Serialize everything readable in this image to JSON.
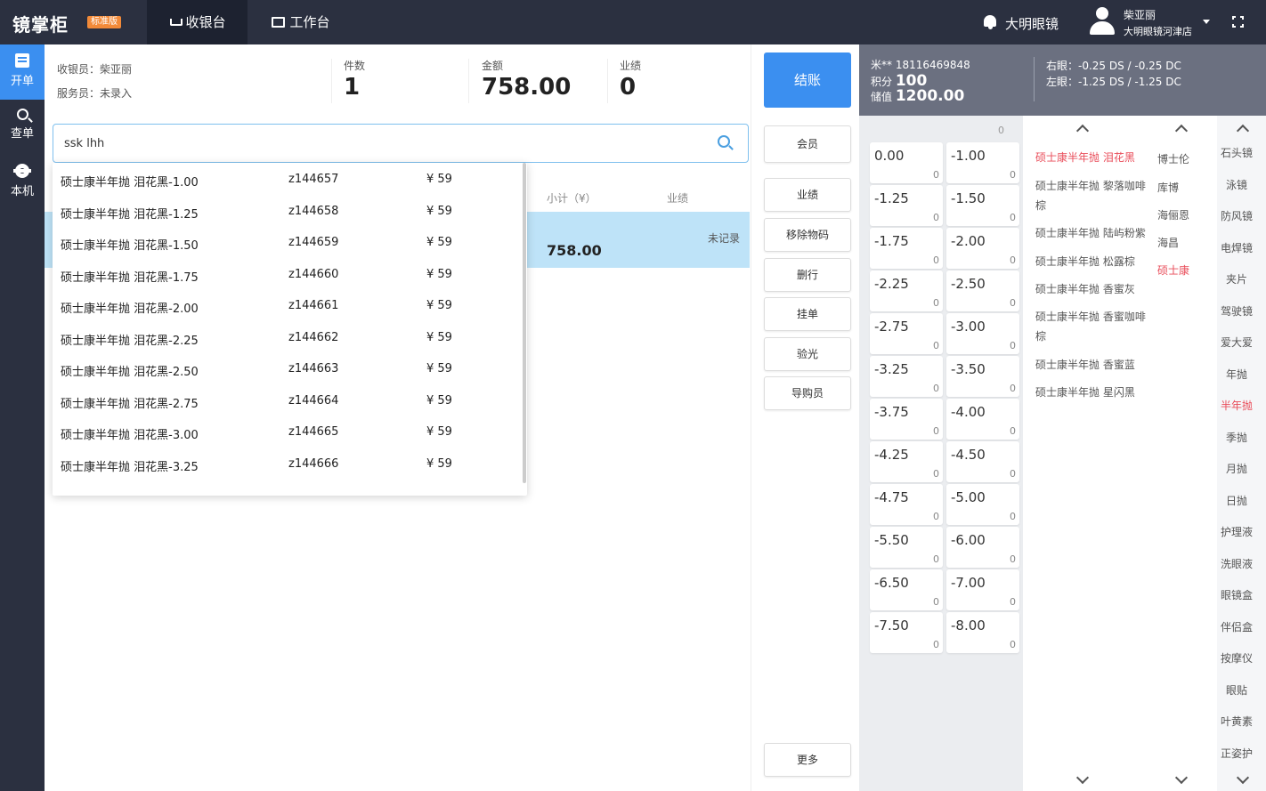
{
  "app": {
    "logo": "镜掌柜",
    "edition": "标准版"
  },
  "nav": {
    "tabs": [
      {
        "label": "收银台"
      },
      {
        "label": "工作台"
      }
    ]
  },
  "header": {
    "store_name": "大明眼镜",
    "user_name": "柴亚丽",
    "user_store": "大明眼镜河津店"
  },
  "sidebar": {
    "items": [
      {
        "label": "开单"
      },
      {
        "label": "查单"
      },
      {
        "label": "本机"
      }
    ]
  },
  "order": {
    "cashier": "收银员：柴亚丽",
    "clerk": "服务员：未录入",
    "count_label": "件数",
    "count_value": "1",
    "amount_label": "金额",
    "amount_value": "758.00",
    "perf_label": "业绩",
    "perf_value": "0"
  },
  "search": {
    "value": "ssk lhh"
  },
  "table": {
    "headers": {
      "subtotal": "小计（¥）",
      "perf": "业绩"
    },
    "row": {
      "subtotal": "758.00",
      "status": "未记录"
    }
  },
  "dropdown": {
    "items": [
      {
        "name": "硕士康半年抛 泪花黑-1.00",
        "code": "z144657",
        "price": "¥ 59"
      },
      {
        "name": "硕士康半年抛 泪花黑-1.25",
        "code": "z144658",
        "price": "¥ 59"
      },
      {
        "name": "硕士康半年抛 泪花黑-1.50",
        "code": "z144659",
        "price": "¥ 59"
      },
      {
        "name": "硕士康半年抛 泪花黑-1.75",
        "code": "z144660",
        "price": "¥ 59"
      },
      {
        "name": "硕士康半年抛 泪花黑-2.00",
        "code": "z144661",
        "price": "¥ 59"
      },
      {
        "name": "硕士康半年抛 泪花黑-2.25",
        "code": "z144662",
        "price": "¥ 59"
      },
      {
        "name": "硕士康半年抛 泪花黑-2.50",
        "code": "z144663",
        "price": "¥ 59"
      },
      {
        "name": "硕士康半年抛 泪花黑-2.75",
        "code": "z144664",
        "price": "¥ 59"
      },
      {
        "name": "硕士康半年抛 泪花黑-3.00",
        "code": "z144665",
        "price": "¥ 59"
      },
      {
        "name": "硕士康半年抛 泪花黑-3.25",
        "code": "z144666",
        "price": "¥ 59"
      }
    ]
  },
  "actions": {
    "checkout": "结账",
    "member": "会员",
    "perf": "业绩",
    "remove": "移除物码",
    "delete_row": "删行",
    "hold": "挂单",
    "optometry": "验光",
    "guide": "导购员",
    "more": "更多"
  },
  "member": {
    "phone": "米** 18116469848",
    "points_label": "积分",
    "points": "100",
    "balance_label": "储值",
    "balance": "1200.00",
    "right_eye": "右眼：-0.25 DS / -0.25 DC",
    "left_eye": "左眼：-1.25 DS / -1.25 DC"
  },
  "degrees": {
    "top_count": "0",
    "items": [
      {
        "v": "0.00",
        "c": "0"
      },
      {
        "v": "-1.00",
        "c": "0"
      },
      {
        "v": "-1.25",
        "c": "0"
      },
      {
        "v": "-1.50",
        "c": "0"
      },
      {
        "v": "-1.75",
        "c": "0"
      },
      {
        "v": "-2.00",
        "c": "0"
      },
      {
        "v": "-2.25",
        "c": "0"
      },
      {
        "v": "-2.50",
        "c": "0"
      },
      {
        "v": "-2.75",
        "c": "0"
      },
      {
        "v": "-3.00",
        "c": "0"
      },
      {
        "v": "-3.25",
        "c": "0"
      },
      {
        "v": "-3.50",
        "c": "0"
      },
      {
        "v": "-3.75",
        "c": "0"
      },
      {
        "v": "-4.00",
        "c": "0"
      },
      {
        "v": "-4.25",
        "c": "0"
      },
      {
        "v": "-4.50",
        "c": "0"
      },
      {
        "v": "-4.75",
        "c": "0"
      },
      {
        "v": "-5.00",
        "c": "0"
      },
      {
        "v": "-5.50",
        "c": "0"
      },
      {
        "v": "-6.00",
        "c": "0"
      },
      {
        "v": "-6.50",
        "c": "0"
      },
      {
        "v": "-7.00",
        "c": "0"
      },
      {
        "v": "-7.50",
        "c": "0"
      },
      {
        "v": "-8.00",
        "c": "0"
      }
    ]
  },
  "products": [
    "硕士康半年抛 泪花黑",
    "硕士康半年抛 黎落咖啡棕",
    "硕士康半年抛 陆屿粉紫",
    "硕士康半年抛 松露棕",
    "硕士康半年抛 香蜜灰",
    "硕士康半年抛 香蜜咖啡棕",
    "硕士康半年抛 香蜜蓝",
    "硕士康半年抛 星闪黑"
  ],
  "brands": [
    "博士伦",
    "库博",
    "海俪恩",
    "海昌",
    "硕士康"
  ],
  "categories": [
    "石头镜",
    "泳镜",
    "防风镜",
    "电焊镜",
    "夹片",
    "驾驶镜",
    "爱大爱",
    "年抛",
    "半年抛",
    "季抛",
    "月抛",
    "日抛",
    "护理液",
    "洗眼液",
    "眼镜盒",
    "伴侣盒",
    "按摩仪",
    "眼贴",
    "叶黄素",
    "正姿护"
  ],
  "colors": {
    "accent": "#3b8ff0",
    "nav_bg": "#2b3040",
    "selected_red": "#e94d5a",
    "row_highlight": "#bee3f8"
  }
}
